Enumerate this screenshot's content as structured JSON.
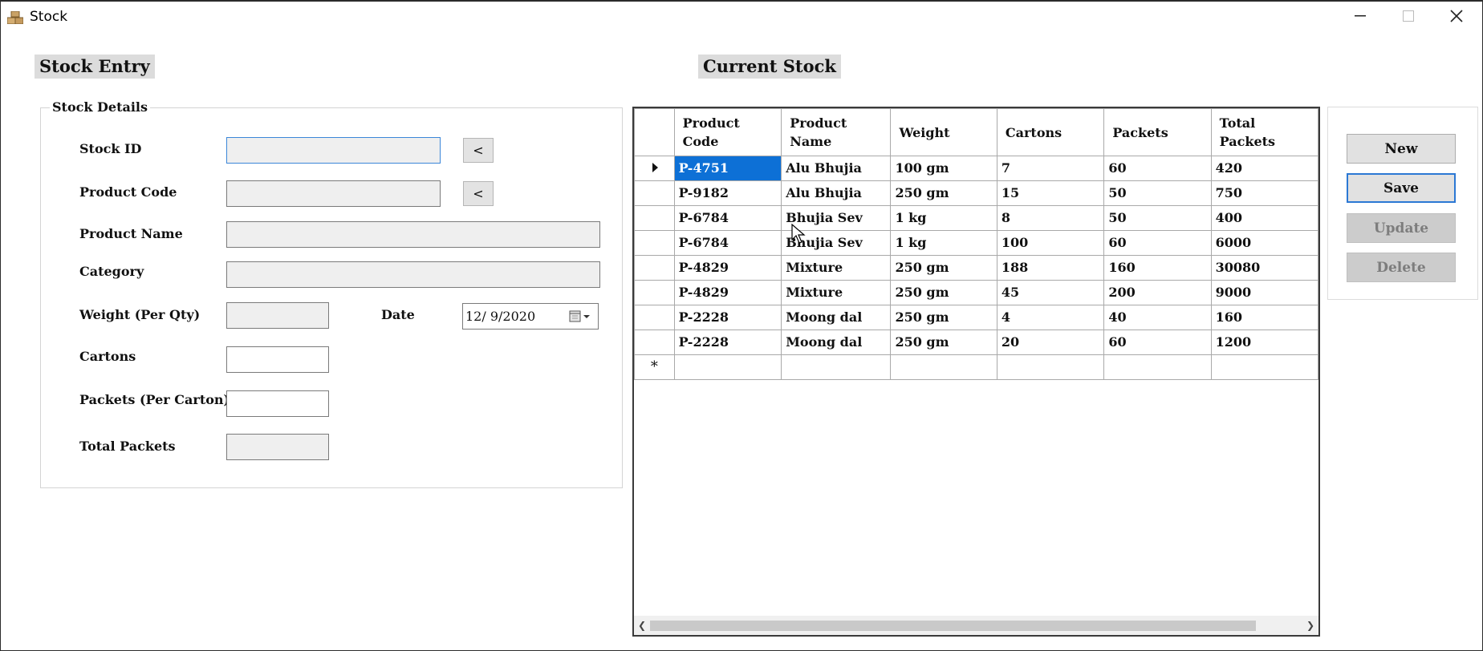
{
  "window": {
    "title": "Stock"
  },
  "entry": {
    "section_title": "Stock Entry",
    "group_title": "Stock Details",
    "fields": {
      "stock_id": {
        "label": "Stock ID",
        "value": ""
      },
      "product_code": {
        "label": "Product Code",
        "value": ""
      },
      "product_name": {
        "label": "Product Name",
        "value": ""
      },
      "category": {
        "label": "Category",
        "value": ""
      },
      "weight": {
        "label": "Weight (Per Qty)",
        "value": ""
      },
      "date": {
        "label": "Date",
        "value": "12/  9/2020"
      },
      "cartons": {
        "label": "Cartons",
        "value": ""
      },
      "packets": {
        "label": "Packets (Per Carton)",
        "value": ""
      },
      "total_packets": {
        "label": "Total Packets",
        "value": ""
      }
    },
    "lookup_button": "<"
  },
  "stock": {
    "section_title": "Current Stock",
    "columns": [
      [
        "Product",
        "Code"
      ],
      [
        "Product",
        "Name"
      ],
      [
        "Weight"
      ],
      [
        "Cartons"
      ],
      [
        "Packets"
      ],
      [
        "Total",
        "Packets"
      ]
    ],
    "rows": [
      [
        "P-4751",
        "Alu Bhujia",
        "100 gm",
        "7",
        "60",
        "420"
      ],
      [
        "P-9182",
        "Alu Bhujia",
        "250 gm",
        "15",
        "50",
        "750"
      ],
      [
        "P-6784",
        "Bhujia Sev",
        "1 kg",
        "8",
        "50",
        "400"
      ],
      [
        "P-6784",
        "Bhujia Sev",
        "1 kg",
        "100",
        "60",
        "6000"
      ],
      [
        "P-4829",
        "Mixture",
        "250 gm",
        "188",
        "160",
        "30080"
      ],
      [
        "P-4829",
        "Mixture",
        "250 gm",
        "45",
        "200",
        "9000"
      ],
      [
        "P-2228",
        "Moong dal",
        "250 gm",
        "4",
        "40",
        "160"
      ],
      [
        "P-2228",
        "Moong dal",
        "250 gm",
        "20",
        "60",
        "1200"
      ]
    ],
    "new_row_marker": "*"
  },
  "actions": {
    "new": "New",
    "save": "Save",
    "update": "Update",
    "delete": "Delete"
  },
  "colors": {
    "selection": "#0d70d6",
    "focus_border": "#3b86d8",
    "section_bg": "#dcdcdc"
  }
}
